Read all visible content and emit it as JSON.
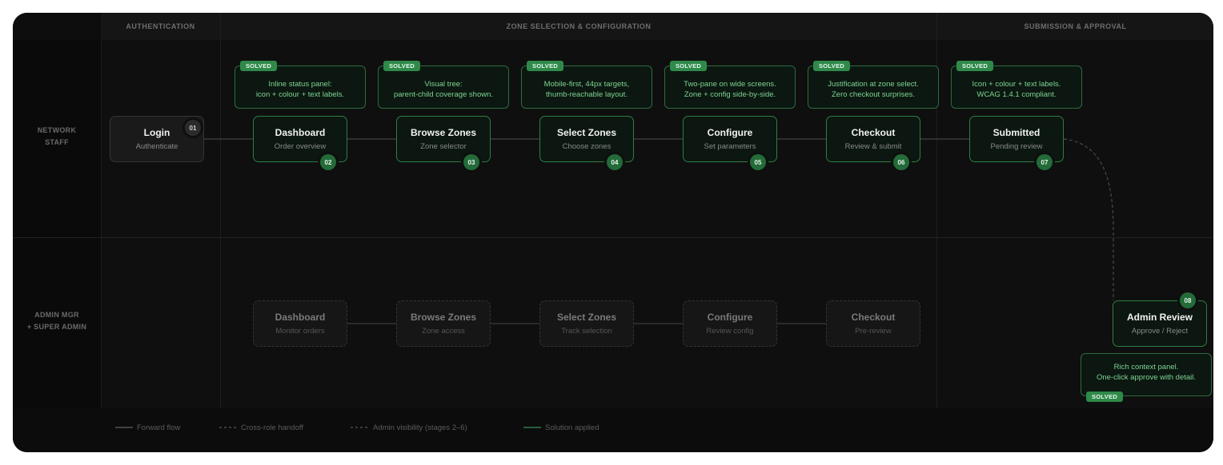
{
  "headers": {
    "authentication": "AUTHENTICATION",
    "zone": "ZONE SELECTION & CONFIGURATION",
    "submission": "SUBMISSION & APPROVAL"
  },
  "lanes": {
    "staff": [
      "NETWORK",
      "STAFF"
    ],
    "admin": [
      "ADMIN MGR",
      "+ SUPER ADMIN"
    ]
  },
  "staff_nodes": [
    {
      "title": "Login",
      "subtitle": "Authenticate",
      "step": "01"
    },
    {
      "title": "Dashboard",
      "subtitle": "Order overview",
      "step": "02"
    },
    {
      "title": "Browse Zones",
      "subtitle": "Zone selector",
      "step": "03"
    },
    {
      "title": "Select Zones",
      "subtitle": "Choose zones",
      "step": "04"
    },
    {
      "title": "Configure",
      "subtitle": "Set parameters",
      "step": "05"
    },
    {
      "title": "Checkout",
      "subtitle": "Review & submit",
      "step": "06"
    },
    {
      "title": "Submitted",
      "subtitle": "Pending review",
      "step": "07"
    }
  ],
  "admin_nodes": [
    {
      "title": "Dashboard",
      "subtitle": "Monitor orders"
    },
    {
      "title": "Browse Zones",
      "subtitle": "Zone access"
    },
    {
      "title": "Select Zones",
      "subtitle": "Track selection"
    },
    {
      "title": "Configure",
      "subtitle": "Review config"
    },
    {
      "title": "Checkout",
      "subtitle": "Pre-review"
    }
  ],
  "admin_review": {
    "title": "Admin Review",
    "subtitle": "Approve / Reject",
    "step": "08"
  },
  "solved_label": "SOLVED",
  "notes": [
    [
      "Inline status panel:",
      "icon + colour + text labels."
    ],
    [
      "Visual tree:",
      "parent-child coverage shown."
    ],
    [
      "Mobile-first, 44px targets,",
      "thumb-reachable layout."
    ],
    [
      "Two-pane on wide screens.",
      "Zone + config side-by-side."
    ],
    [
      "Justification at zone select.",
      "Zero checkout surprises."
    ],
    [
      "Icon + colour + text labels.",
      "WCAG 1.4.1 compliant."
    ],
    [
      "Rich context panel.",
      "One-click approve with detail."
    ]
  ],
  "legend": {
    "forward": "Forward flow",
    "handoff": "Cross-role handoff",
    "visibility": "Admin visibility (stages 2–6)",
    "solution": "Solution applied"
  },
  "colors": {
    "accent": "#2d7d46",
    "solved_badge": "#2f8a4a",
    "note_text": "#7fd493",
    "background": "#0f0f0f"
  }
}
